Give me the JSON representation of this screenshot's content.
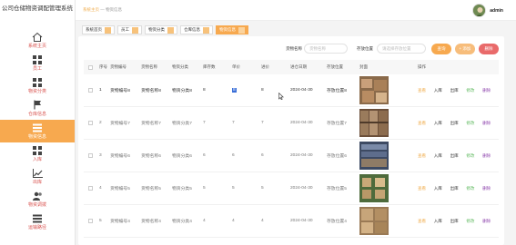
{
  "app": {
    "title": "公司仓储物资调配管理系统"
  },
  "nav": [
    {
      "label": "系统主页",
      "icon": "home-icon",
      "active": false
    },
    {
      "label": "员工",
      "icon": "grid-icon",
      "active": false
    },
    {
      "label": "物资分类",
      "icon": "grid-icon",
      "active": false
    },
    {
      "label": "仓库信息",
      "icon": "flag-icon",
      "active": false
    },
    {
      "label": "物资信息",
      "icon": "list-icon",
      "active": true
    },
    {
      "label": "入库",
      "icon": "grid-icon",
      "active": false
    },
    {
      "label": "出库",
      "icon": "chart-icon",
      "active": false
    },
    {
      "label": "物资调拨",
      "icon": "users-icon",
      "active": false
    },
    {
      "label": "运输路径",
      "icon": "list-icon",
      "active": false
    }
  ],
  "header": {
    "breadcrumb_home": "系统主页",
    "breadcrumb_sep": "—",
    "breadcrumb_current": "物资信息",
    "username": "admin"
  },
  "tabs": [
    "系统首页",
    "员工",
    "物资分类",
    "仓库信息",
    "物资信息"
  ],
  "search": {
    "name_label": "货物名称",
    "name_placeholder": "货物名称",
    "loc_label": "存放位置",
    "loc_placeholder": "请选择存放位置",
    "search_btn": "查询",
    "add_btn": "+ 添加",
    "delete_btn": "删除"
  },
  "columns": [
    "序号",
    "货物编号",
    "货物名称",
    "物资分类",
    "库存数",
    "单价",
    "进价",
    "进仓日期",
    "存放位置",
    "封面",
    "操作"
  ],
  "rows": [
    {
      "idx": "1",
      "num": "货物编号8",
      "name": "货物名称8",
      "cat": "物资分类8",
      "stock": "8",
      "price": "8",
      "buy": "8",
      "date": "2024-04-30",
      "loc": "存放位置8"
    },
    {
      "idx": "2",
      "num": "货物编号7",
      "name": "货物名称7",
      "cat": "物资分类7",
      "stock": "7",
      "price": "7",
      "buy": "7",
      "date": "2024-04-30",
      "loc": "存放位置7"
    },
    {
      "idx": "3",
      "num": "货物编号6",
      "name": "货物名称6",
      "cat": "物资分类6",
      "stock": "6",
      "price": "6",
      "buy": "6",
      "date": "2024-04-30",
      "loc": "存放位置6"
    },
    {
      "idx": "4",
      "num": "货物编号5",
      "name": "货物名称5",
      "cat": "物资分类5",
      "stock": "5",
      "price": "5",
      "buy": "5",
      "date": "2024-04-30",
      "loc": "存放位置5"
    },
    {
      "idx": "5",
      "num": "货物编号4",
      "name": "货物名称4",
      "cat": "物资分类4",
      "stock": "4",
      "price": "4",
      "buy": "4",
      "date": "2024-04-30",
      "loc": "存放位置4"
    }
  ],
  "ops": {
    "view": "查看",
    "in": "入库",
    "out": "出库",
    "edit": "修改",
    "del": "删除"
  },
  "colors": {
    "accent": "#f7a94f",
    "danger": "#e96a6a",
    "success": "#5cb85c"
  }
}
